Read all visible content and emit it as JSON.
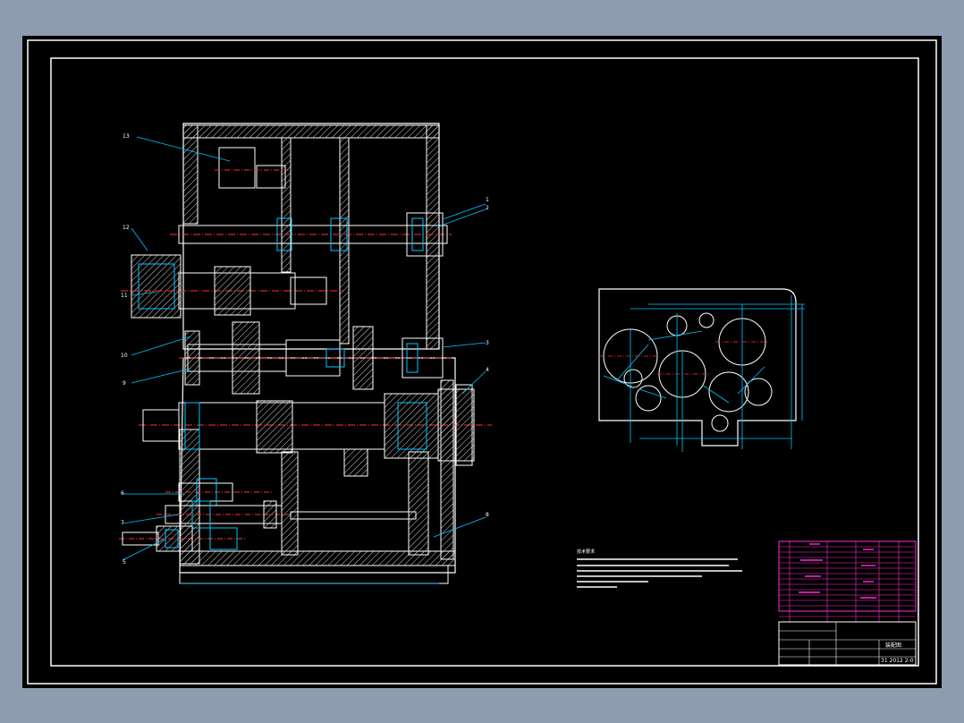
{
  "colors": {
    "background": "#8e9bb1",
    "sheet": "#000000",
    "outline": "#ffffff",
    "dimension": "#00c8ff",
    "centerline": "#ff3030",
    "parts_table": "#ff2fd0",
    "hatch": "#ffffff"
  },
  "section_view": {
    "balloons": [
      "13",
      "12",
      "11",
      "10",
      "9",
      "1",
      "2",
      "3",
      "4",
      "5",
      "6",
      "7",
      "8"
    ]
  },
  "title_block": {
    "drawing_number": "31 2012 2-0",
    "name": "装配图"
  },
  "notes": {
    "heading": "技术要求"
  },
  "icons": [
    "gearbox-section-drawing",
    "gear-layout-view",
    "parts-list-table"
  ]
}
